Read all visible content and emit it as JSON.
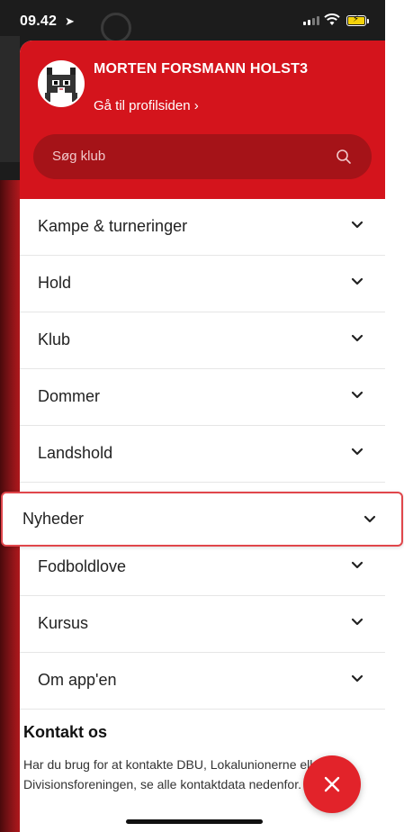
{
  "status_bar": {
    "time": "09.42"
  },
  "profile": {
    "name": "MORTEN FORSMANN HOLST3",
    "link_label": "Gå til profilsiden ›"
  },
  "search": {
    "placeholder": "Søg klub"
  },
  "menu": {
    "items": [
      {
        "label": "Kampe & turneringer"
      },
      {
        "label": "Hold"
      },
      {
        "label": "Klub"
      },
      {
        "label": "Dommer"
      },
      {
        "label": "Landshold"
      },
      {
        "label": "Nyheder"
      },
      {
        "label": "Fodboldlove"
      },
      {
        "label": "Kursus"
      },
      {
        "label": "Om app'en"
      }
    ]
  },
  "contact": {
    "title": "Kontakt os",
    "text": "Har du brug for at kontakte DBU, Lokalunionerne eller Divisionsforeningen, se alle kontaktdata nedenfor."
  },
  "colors": {
    "brand_red": "#d4141c",
    "search_bg": "#a51318",
    "highlight_border": "#e0464b"
  }
}
